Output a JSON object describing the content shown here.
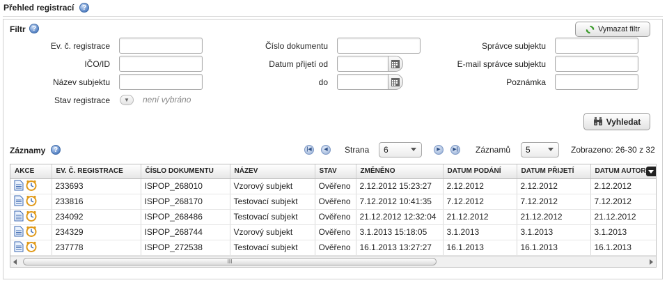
{
  "page": {
    "title": "Přehled registrací"
  },
  "filter": {
    "title": "Filtr",
    "clear_button": "Vymazat filtr",
    "search_button": "Vyhledat",
    "labels": {
      "ev_reg": "Ev. č. registrace",
      "ico": "IČO/ID",
      "nazev": "Název subjektu",
      "stav": "Stav registrace",
      "cislo_dok": "Číslo dokumentu",
      "datum_od": "Datum přijetí od",
      "do": "do",
      "spravce": "Správce subjektu",
      "email": "E-mail správce subjektu",
      "poznamka": "Poznámka"
    },
    "values": {
      "ev_reg": "",
      "ico": "",
      "nazev": "",
      "cislo_dok": "",
      "datum_od": "",
      "do": "",
      "spravce": "",
      "email": "",
      "poznamka": ""
    },
    "stav_value": "není vybráno"
  },
  "records": {
    "title": "Záznamy",
    "strana_label": "Strana",
    "strana_value": "6",
    "zaznamu_label": "Záznamů",
    "zaznamu_value": "5",
    "zobrazeno": "Zobrazeno: 26-30 z 32",
    "columns": [
      "AKCE",
      "EV. Č. REGISTRACE",
      "ČÍSLO DOKUMENTU",
      "NÁZEV",
      "STAV",
      "ZMĚNĚNO",
      "DATUM PODÁNÍ",
      "DATUM PŘIJETÍ",
      "DATUM AUTOR"
    ],
    "rows": [
      [
        "233693",
        "ISPOP_268010",
        "Vzorový subjekt",
        "Ověřeno",
        "2.12.2012 15:23:27",
        "2.12.2012",
        "2.12.2012",
        "2.12.2012"
      ],
      [
        "233816",
        "ISPOP_268170",
        "Testovací subjekt",
        "Ověřeno",
        "7.12.2012 10:41:35",
        "7.12.2012",
        "7.12.2012",
        "7.12.2012"
      ],
      [
        "234092",
        "ISPOP_268486",
        "Testovací subjekt",
        "Ověřeno",
        "21.12.2012 12:32:04",
        "21.12.2012",
        "21.12.2012",
        "21.12.2012"
      ],
      [
        "234329",
        "ISPOP_268744",
        "Vzorový subjekt",
        "Ověřeno",
        "3.1.2013 15:18:05",
        "3.1.2013",
        "3.1.2013",
        "3.1.2013"
      ],
      [
        "237778",
        "ISPOP_272538",
        "Testovací subjekt",
        "Ověřeno",
        "16.1.2013 13:27:27",
        "16.1.2013",
        "16.1.2013",
        "16.1.2013"
      ]
    ],
    "scroll_grip": "III"
  },
  "icons": {
    "help": "help-icon",
    "refresh": "refresh-icon",
    "binoculars": "binoculars-icon",
    "calendar": "calendar-icon",
    "document": "document-icon",
    "clock": "clock-icon"
  }
}
